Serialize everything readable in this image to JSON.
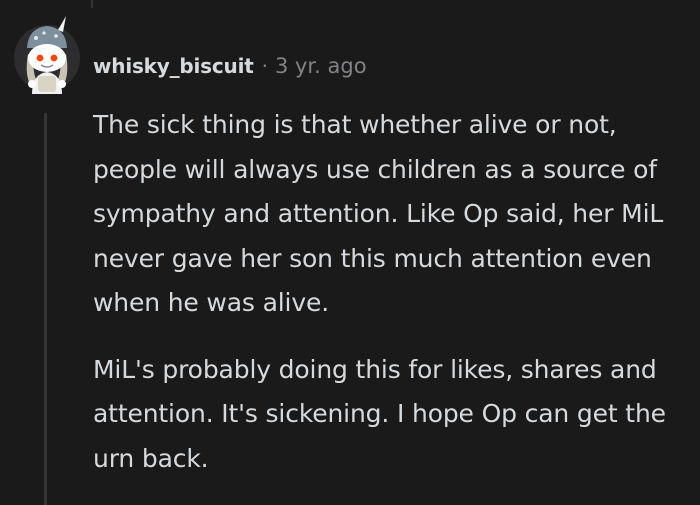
{
  "comment": {
    "username": "whisky_biscuit",
    "separator": "·",
    "timestamp": "3 yr. ago",
    "paragraphs": [
      "The sick thing is that whether alive or not, people will always use children as a source of sympathy and attention. Like Op said, her MiL never gave her son this much attention even when he was alive.",
      "MiL's probably doing this for likes, shares and attention. It's sickening. I hope Op can get the urn back."
    ]
  },
  "colors": {
    "background": "#1a1a1b",
    "text": "#d7dadc",
    "meta": "#818384",
    "thread_line": "#343536"
  },
  "icons": {
    "avatar": "snoo-avatar-unicorn-hat"
  }
}
